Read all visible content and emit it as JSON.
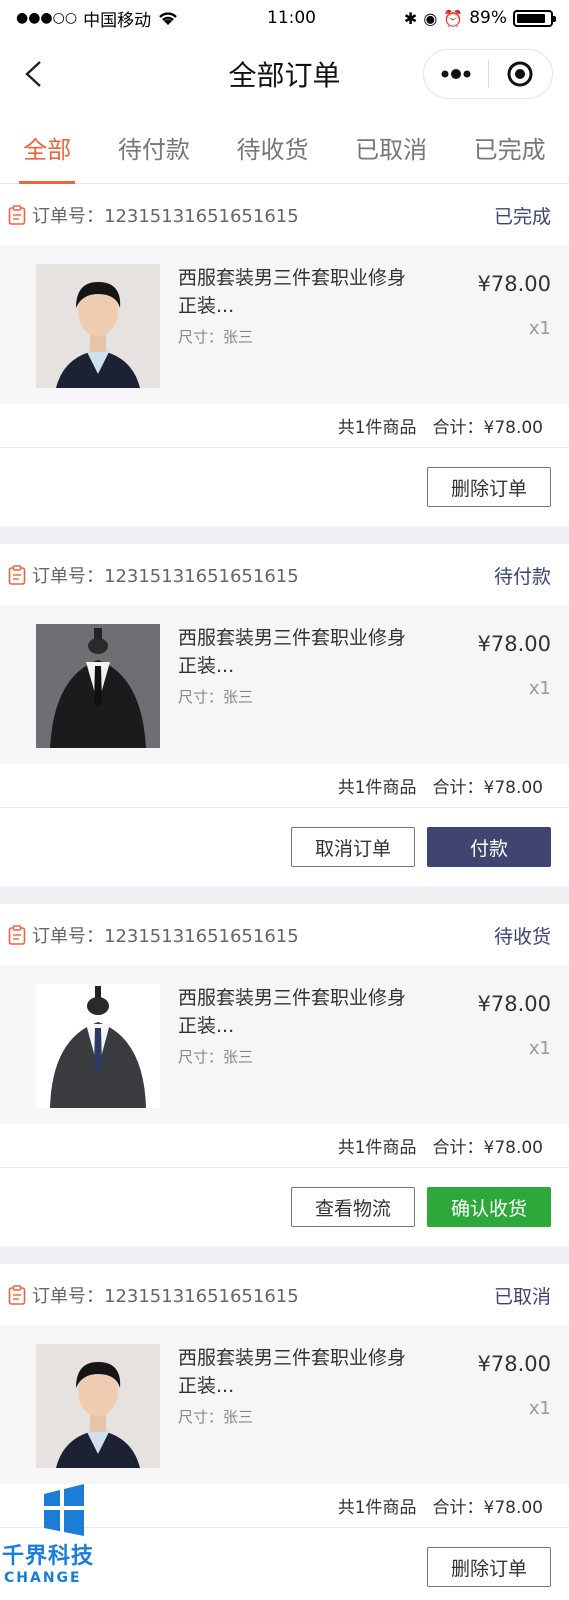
{
  "status_bar": {
    "carrier": "中国移动",
    "time": "11:00",
    "battery": "89%",
    "battery_level": 0.89
  },
  "nav": {
    "title": "全部订单",
    "more_icon": "more-dots-icon",
    "close_icon": "target-circle-icon"
  },
  "tabs": [
    {
      "label": "全部",
      "active": true
    },
    {
      "label": "待付款",
      "active": false
    },
    {
      "label": "待收货",
      "active": false
    },
    {
      "label": "已取消",
      "active": false
    },
    {
      "label": "已完成",
      "active": false
    }
  ],
  "orders": [
    {
      "order_no": "订单号：12315131651651615",
      "status": "已完成",
      "product_name": "西服套装男三件套职业修身正装...",
      "spec": "尺寸：张三",
      "price": "¥78.00",
      "qty": "x1",
      "count_text": "共1件商品",
      "total_text": "合计：¥78.00",
      "actions": [
        "删除订单"
      ]
    },
    {
      "order_no": "订单号：12315131651651615",
      "status": "待付款",
      "product_name": "西服套装男三件套职业修身正装...",
      "spec": "尺寸：张三",
      "price": "¥78.00",
      "qty": "x1",
      "count_text": "共1件商品",
      "total_text": "合计：¥78.00",
      "actions": [
        "取消订单",
        "付款"
      ]
    },
    {
      "order_no": "订单号：12315131651651615",
      "status": "待收货",
      "product_name": "西服套装男三件套职业修身正装...",
      "spec": "尺寸：张三",
      "price": "¥78.00",
      "qty": "x1",
      "count_text": "共1件商品",
      "total_text": "合计：¥78.00",
      "actions": [
        "查看物流",
        "确认收货"
      ]
    },
    {
      "order_no": "订单号：12315131651651615",
      "status": "已取消",
      "product_name": "西服套装男三件套职业修身正装...",
      "spec": "尺寸：张三",
      "price": "¥78.00",
      "qty": "x1",
      "count_text": "共1件商品",
      "total_text": "合计：¥78.00",
      "actions": [
        "删除订单"
      ]
    }
  ],
  "watermark": {
    "name": "千界科技",
    "sub": "CHANGE"
  },
  "colors": {
    "accent": "#e8663d",
    "status": "#3f4570",
    "pay_button": "#3f4570",
    "confirm_button": "#2ea83a",
    "watermark": "#1a7dd6"
  }
}
